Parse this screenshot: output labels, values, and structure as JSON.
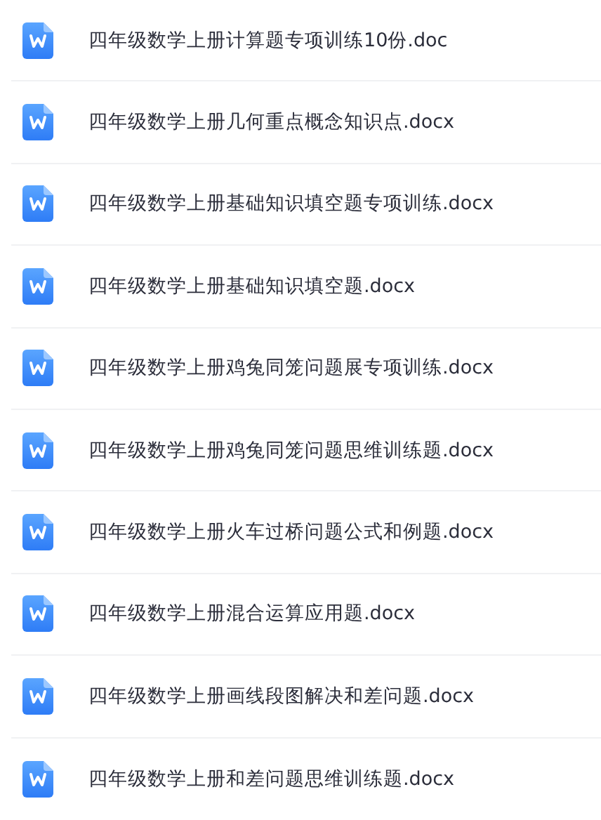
{
  "files": [
    {
      "name": "四年级数学上册计算题专项训练10份.doc"
    },
    {
      "name": "四年级数学上册几何重点概念知识点.docx"
    },
    {
      "name": "四年级数学上册基础知识填空题专项训练.docx"
    },
    {
      "name": "四年级数学上册基础知识填空题.docx"
    },
    {
      "name": "四年级数学上册鸡兔同笼问题展专项训练.docx"
    },
    {
      "name": "四年级数学上册鸡兔同笼问题思维训练题.docx"
    },
    {
      "name": "四年级数学上册火车过桥问题公式和例题.docx"
    },
    {
      "name": "四年级数学上册混合运算应用题.docx"
    },
    {
      "name": "四年级数学上册画线段图解决和差问题.docx"
    },
    {
      "name": "四年级数学上册和差问题思维训练题.docx"
    }
  ]
}
